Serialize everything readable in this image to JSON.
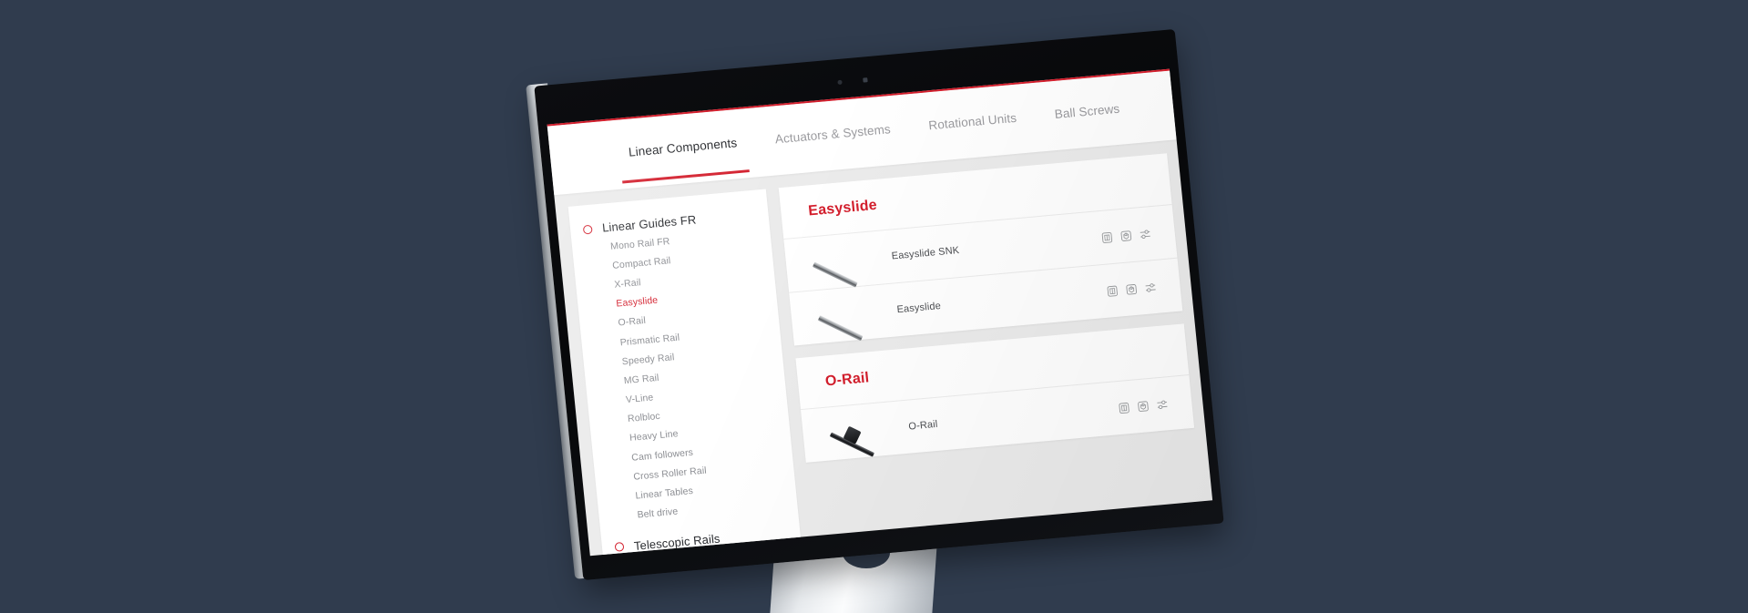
{
  "colors": {
    "background": "#303c4e",
    "accent_red": "#d31e2c",
    "page_bg": "#ebebeb",
    "card_white": "#ffffff",
    "bezel_black": "#0b0c0f",
    "frame_silver": "#e8ebee"
  },
  "tabs": [
    {
      "label": "Linear Components",
      "active": true
    },
    {
      "label": "Actuators & Systems",
      "active": false
    },
    {
      "label": "Rotational Units",
      "active": false
    },
    {
      "label": "Ball Screws",
      "active": false
    }
  ],
  "sidebar": {
    "groups": [
      {
        "label": "Linear Guides FR",
        "items": [
          {
            "label": "Mono Rail FR",
            "active": false
          },
          {
            "label": "Compact Rail",
            "active": false
          },
          {
            "label": "X-Rail",
            "active": false
          },
          {
            "label": "Easyslide",
            "active": true
          },
          {
            "label": "O-Rail",
            "active": false
          },
          {
            "label": "Prismatic Rail",
            "active": false
          },
          {
            "label": "Speedy Rail",
            "active": false
          },
          {
            "label": "MG Rail",
            "active": false
          },
          {
            "label": "V-Line",
            "active": false
          },
          {
            "label": "Rolbloc",
            "active": false
          },
          {
            "label": "Heavy Line",
            "active": false
          },
          {
            "label": "Cam followers",
            "active": false
          },
          {
            "label": "Cross Roller Rail",
            "active": false
          },
          {
            "label": "Linear Tables",
            "active": false
          },
          {
            "label": "Belt drive",
            "active": false
          }
        ]
      },
      {
        "label": "Telescopic Rails",
        "items": []
      }
    ]
  },
  "content": {
    "sections": [
      {
        "title": "Easyslide",
        "products": [
          {
            "name": "Easyslide SNK",
            "thumb": "linear-rail-light"
          },
          {
            "name": "Easyslide",
            "thumb": "linear-rail-light"
          }
        ]
      },
      {
        "title": "O-Rail",
        "products": [
          {
            "name": "O-Rail",
            "thumb": "o-rail-dark"
          }
        ]
      }
    ],
    "row_actions": [
      {
        "name": "datasheet-icon",
        "title": "Datasheet"
      },
      {
        "name": "cad-model-icon",
        "title": "3D CAD model"
      },
      {
        "name": "configure-icon",
        "title": "Configure"
      }
    ]
  }
}
